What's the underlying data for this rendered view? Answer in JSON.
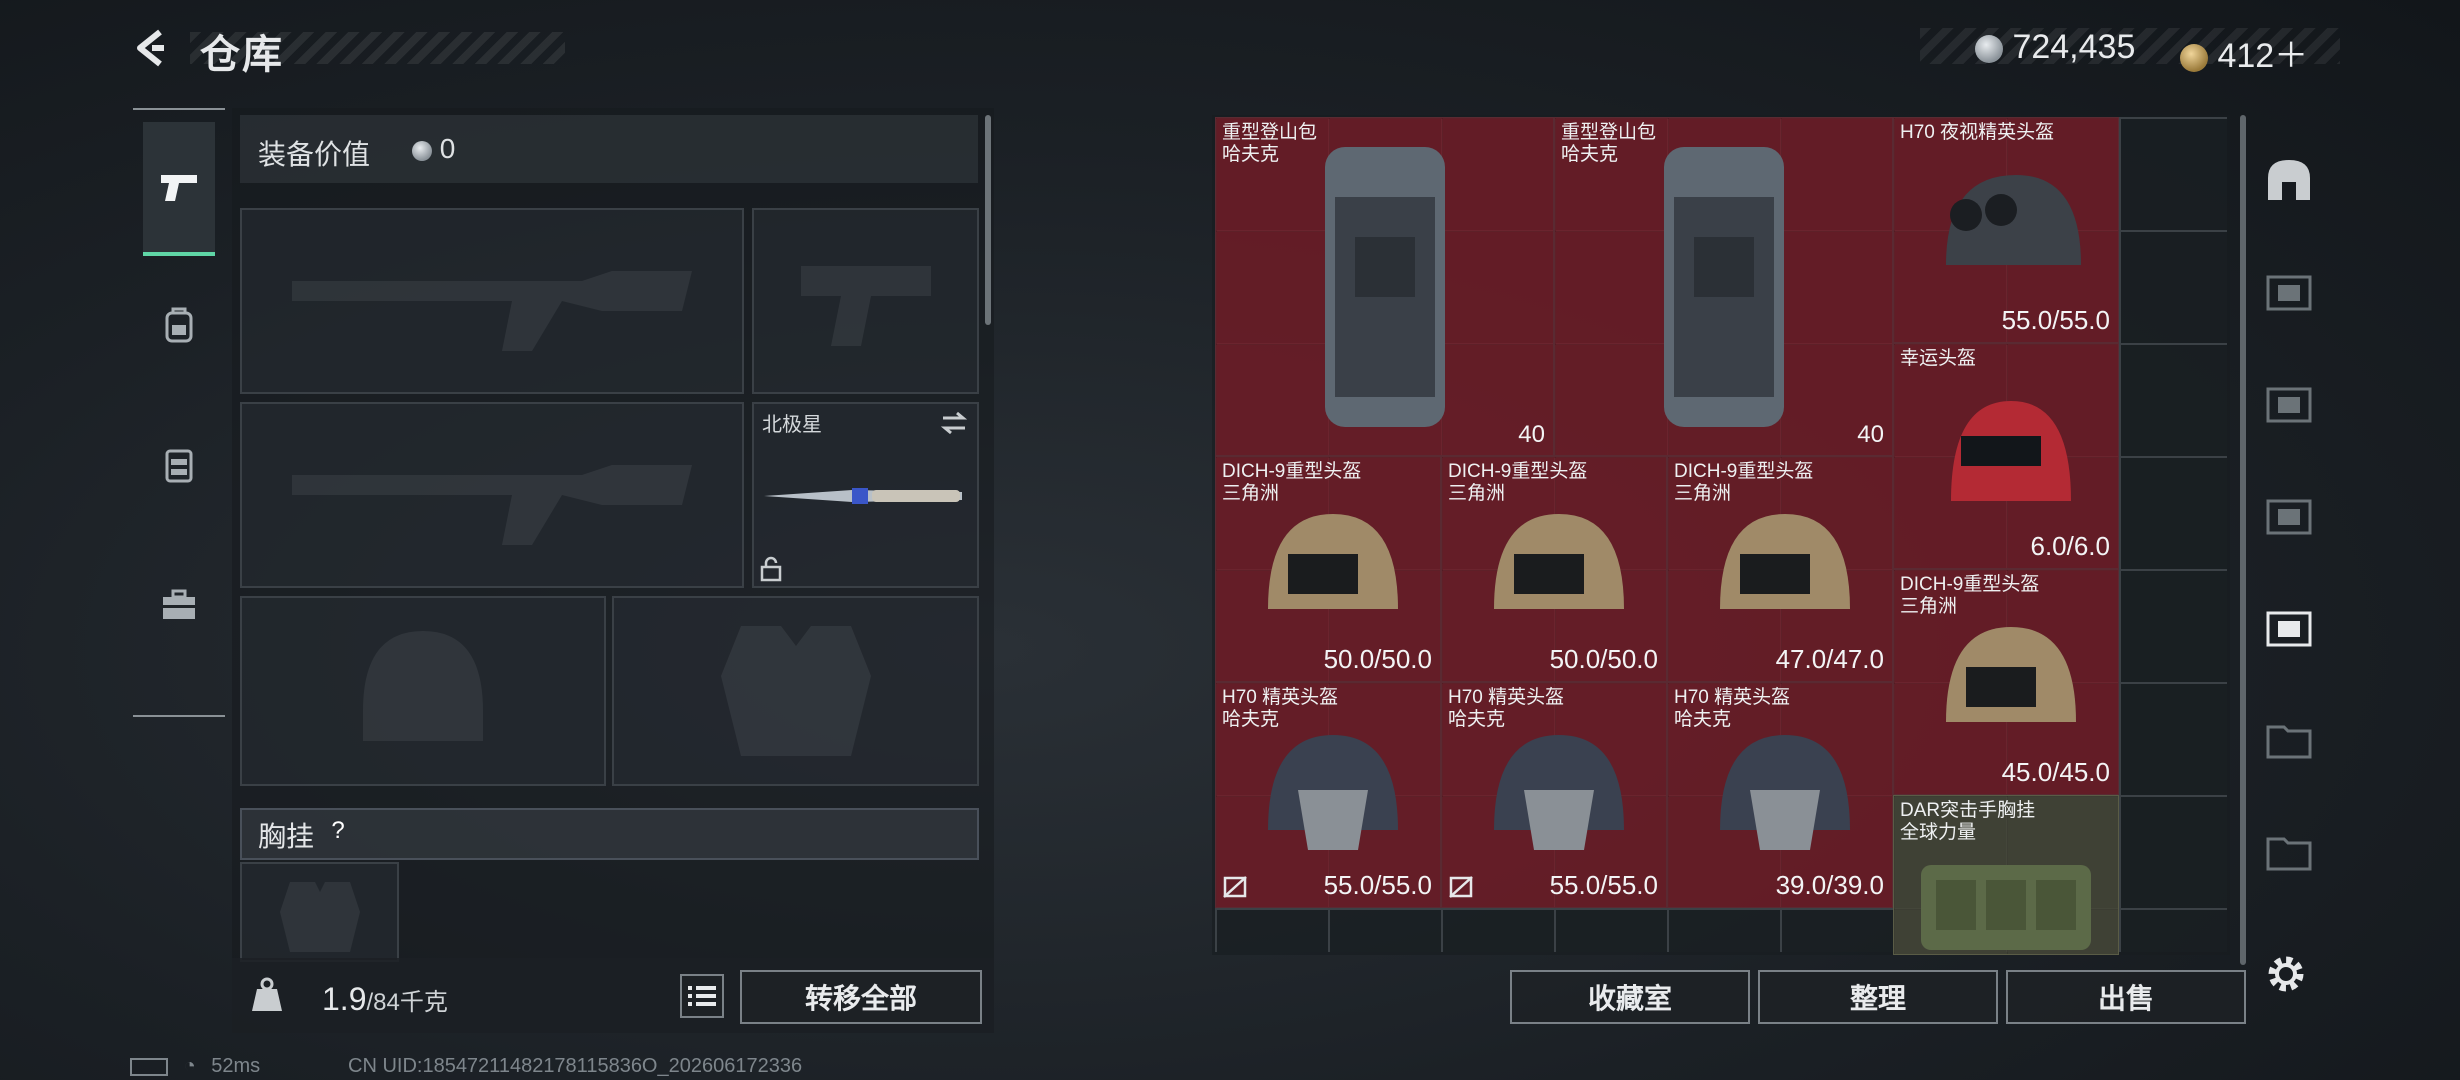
{
  "header": {
    "title": "仓库"
  },
  "currency": {
    "silver": "724,435",
    "gold": "412＋"
  },
  "left_tabs": [
    {
      "icon": "pistol-icon",
      "active": true
    },
    {
      "icon": "backpack-icon",
      "active": false
    },
    {
      "icon": "vest-icon",
      "active": false
    },
    {
      "icon": "toolbox-icon",
      "active": false
    }
  ],
  "equipment": {
    "value_label": "装备价值",
    "value": "0",
    "melee_name": "北极星",
    "chest_label": "胸挂",
    "help": "?",
    "weight_value": "1.9",
    "weight_unit": "/84千克",
    "transfer_all": "转移全部"
  },
  "stash_items": [
    {
      "name1": "重型登山包",
      "name2": "哈夫克",
      "cap": "40",
      "kind": "backpack"
    },
    {
      "name1": "重型登山包",
      "name2": "哈夫克",
      "cap": "40",
      "kind": "backpack"
    },
    {
      "name1": "H70 夜视精英头盔",
      "name2": "",
      "dur": "55.0/55.0",
      "kind": "nvg"
    },
    {
      "name1": "幸运头盔",
      "name2": "",
      "dur": "6.0/6.0",
      "kind": "red"
    },
    {
      "name1": "DICH-9重型头盔",
      "name2": "三角洲",
      "dur": "50.0/50.0",
      "kind": "tan"
    },
    {
      "name1": "DICH-9重型头盔",
      "name2": "三角洲",
      "dur": "50.0/50.0",
      "kind": "tan"
    },
    {
      "name1": "DICH-9重型头盔",
      "name2": "三角洲",
      "dur": "47.0/47.0",
      "kind": "tan"
    },
    {
      "name1": "DICH-9重型头盔",
      "name2": "三角洲",
      "dur": "45.0/45.0",
      "kind": "tan"
    },
    {
      "name1": "H70 精英头盔",
      "name2": "哈夫克",
      "dur": "55.0/55.0",
      "kind": "h70"
    },
    {
      "name1": "H70 精英头盔",
      "name2": "哈夫克",
      "dur": "55.0/55.0",
      "kind": "h70"
    },
    {
      "name1": "H70 精英头盔",
      "name2": "哈夫克",
      "dur": "39.0/39.0",
      "kind": "h70"
    },
    {
      "name1": "DAR突击手胸挂",
      "name2": "全球力量",
      "kind": "rig"
    }
  ],
  "buttons": {
    "collection": "收藏室",
    "organize": "整理",
    "sell": "出售"
  },
  "status": {
    "ping": "52ms",
    "uid": "CN UID:18547211482178115836O_202606172336"
  }
}
